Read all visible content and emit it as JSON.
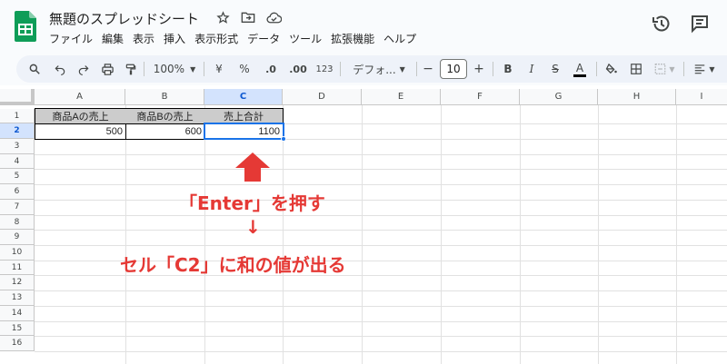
{
  "app": {
    "doc_title": "無題のスプレッドシート",
    "brand_color": "#0f9d58",
    "accent_color": "#1a73e8"
  },
  "menu": [
    "ファイル",
    "編集",
    "表示",
    "挿入",
    "表示形式",
    "データ",
    "ツール",
    "拡張機能",
    "ヘルプ"
  ],
  "toolbar": {
    "zoom": "100%",
    "currency": "¥",
    "percent": "%",
    "dec_decrease": ".0",
    "dec_increase": ".00",
    "number_format": "123",
    "font_name": "デフォ...",
    "minus": "−",
    "font_size": "10",
    "plus": "+",
    "bold": "B",
    "italic": "I",
    "strike": "S",
    "text_color": "A"
  },
  "sheet": {
    "columns": [
      "A",
      "B",
      "C",
      "D",
      "E",
      "F",
      "G",
      "H",
      "I"
    ],
    "rows": [
      "1",
      "2",
      "3",
      "4",
      "5",
      "6",
      "7",
      "8",
      "9",
      "10",
      "11",
      "12",
      "13",
      "14",
      "15",
      "16"
    ],
    "selected_cell": "C2",
    "cells": {
      "A1": "商品Aの売上",
      "B1": "商品Bの売上",
      "C1": "売上合計",
      "A2": "500",
      "B2": "600",
      "C2": "1100"
    }
  },
  "annotation": {
    "line1": "「Enter」を押す",
    "arrow": "↓",
    "line2": "セル「C2」に和の値が出る",
    "color": "#e53935"
  }
}
